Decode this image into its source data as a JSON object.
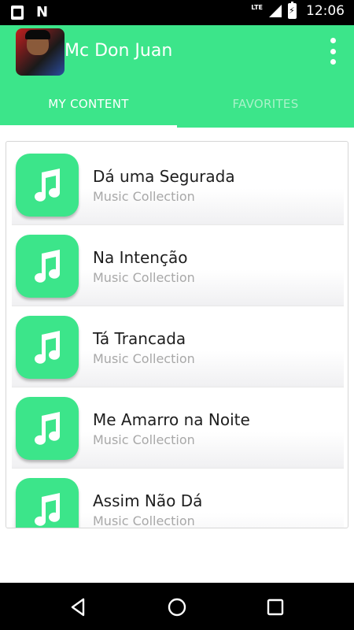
{
  "status_bar": {
    "network": "LTE",
    "time": "12:06"
  },
  "app_bar": {
    "icon_text": "Mc Don Juan",
    "title": "Mc Don Juan",
    "menu_icon": "more-vert-icon"
  },
  "tabs": [
    {
      "label": "MY CONTENT",
      "active": true
    },
    {
      "label": "FAVORITES",
      "active": false
    }
  ],
  "list": {
    "icon": "music-note-icon",
    "accent_color": "#3ce58a",
    "items": [
      {
        "title": "Dá uma Segurada",
        "subtitle": "Music Collection"
      },
      {
        "title": "Na Intenção",
        "subtitle": "Music Collection"
      },
      {
        "title": "Tá Trancada",
        "subtitle": "Music Collection"
      },
      {
        "title": "Me Amarro na Noite",
        "subtitle": "Music Collection"
      },
      {
        "title": "Assim Não Dá",
        "subtitle": "Music Collection"
      }
    ]
  },
  "nav_bar": {
    "back_icon": "back-triangle-icon",
    "home_icon": "home-circle-icon",
    "recents_icon": "recents-square-icon"
  }
}
